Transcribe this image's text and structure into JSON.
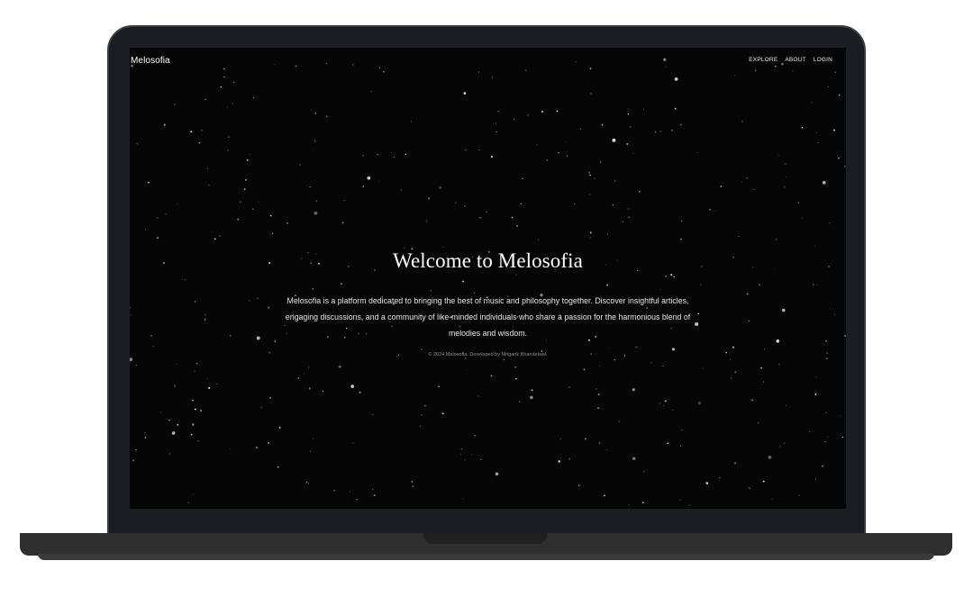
{
  "app": {
    "brand": "Melosofia"
  },
  "nav": {
    "items": [
      {
        "label": "EXPLORE"
      },
      {
        "label": "ABOUT"
      },
      {
        "label": "LOGIN"
      }
    ]
  },
  "hero": {
    "title": "Welcome to Melosofia",
    "description": "Melosofia is a platform dedicated to bringing the best of music and philosophy together. Discover insightful articles, engaging discussions, and a community of like-minded individuals who share a passion for the harmonious blend of melodies and wisdom."
  },
  "footer": {
    "text": "© 2024 Melosofia. Developed by Mrigank Khandelwal."
  },
  "colors": {
    "screen_background": "#050505",
    "device_frame": "#1a1d21",
    "device_base": "#2f2f2f",
    "text_primary": "#ffffff"
  }
}
